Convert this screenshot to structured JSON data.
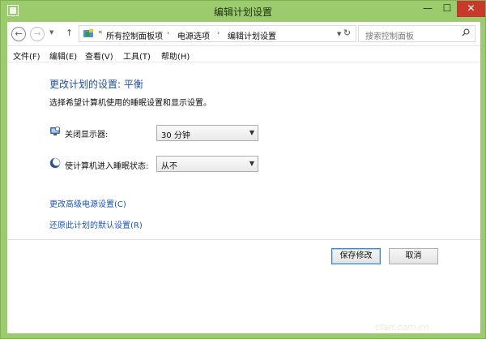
{
  "window": {
    "title": "编辑计划设置",
    "minimize": "—",
    "maximize": "☐",
    "close": "✕"
  },
  "nav": {
    "back": "←",
    "forward": "→",
    "dropdown": "▼",
    "up": "↑",
    "breadcrumb_overflow": "«",
    "breadcrumbs": [
      "所有控制面板项",
      "电源选项",
      "编辑计划设置"
    ],
    "breadcrumb_separator": "›",
    "refresh": "↻"
  },
  "search": {
    "placeholder": "搜索控制面板"
  },
  "menu": {
    "items": [
      "文件(F)",
      "编辑(E)",
      "查看(V)",
      "工具(T)",
      "帮助(H)"
    ]
  },
  "main": {
    "title": "更改计划的设置: 平衡",
    "subtitle": "选择希望计算机使用的睡眠设置和显示设置。",
    "options": [
      {
        "label": "关闭显示器:",
        "value": "30 分钟",
        "icon": "monitor-icon"
      },
      {
        "label": "使计算机进入睡眠状态:",
        "value": "从不",
        "icon": "moon-icon"
      }
    ],
    "links": [
      "更改高级电源设置(C)",
      "还原此计划的默认设置(R)"
    ],
    "buttons": {
      "save": "保存修改",
      "cancel": "取消"
    }
  },
  "watermark": "cfan.com.cn",
  "colors": {
    "accent": "#1f4f9d",
    "link": "#1a56b8",
    "frame": "#9ccb6e",
    "close": "#c7392b"
  }
}
